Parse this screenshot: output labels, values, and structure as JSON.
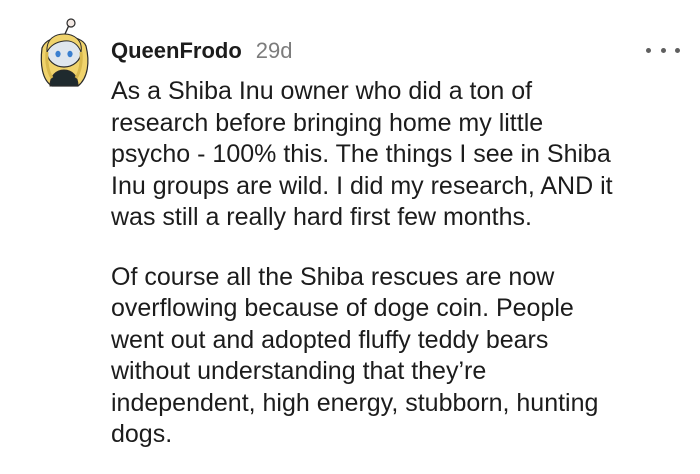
{
  "comment": {
    "author": "QueenFrodo",
    "age": "29d",
    "avatar_icon": "snoo-avatar-icon",
    "menu_icon": "more-options-icon",
    "paragraphs": [
      {
        "lines": [
          "As a Shiba Inu owner who did a ton of",
          "research before bringing home my little",
          "psycho - 100% this. The things I see in Shiba",
          "Inu groups are wild. I did my research, AND it",
          "was still a really hard first few months."
        ]
      },
      {
        "lines": [
          "Of course all the Shiba rescues are now",
          "overflowing because of doge coin. People",
          "went out and adopted fluffy teddy bears",
          "without understanding that they’re",
          "independent, high energy, stubborn, hunting",
          "dogs."
        ]
      }
    ]
  }
}
